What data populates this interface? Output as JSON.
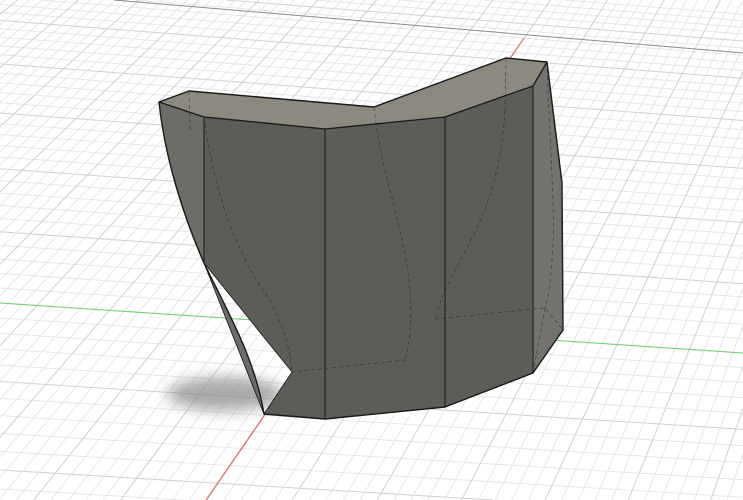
{
  "viewport": {
    "colors": {
      "background": "#ffffff",
      "grid_minor": "#e2e2e2",
      "grid_major": "#cfcfcf",
      "x_axis": "#e06060",
      "y_axis": "#6fd36f",
      "body_front": "#5d5d58",
      "body_left": "#6d6c67",
      "body_inner": "#8c897f",
      "body_right": "#73726c",
      "edge": "#1a1a1a"
    }
  }
}
